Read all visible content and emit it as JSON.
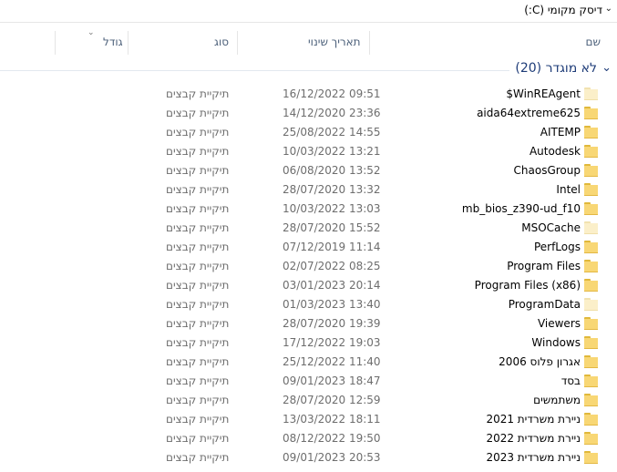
{
  "window": {
    "title": "דיסק מקומי (C:)"
  },
  "columns": {
    "name": "שם",
    "date_modified": "תאריך שינוי",
    "type": "סוג",
    "size": "גודל"
  },
  "group": {
    "label": "לא מוגדר (20)"
  },
  "files": [
    {
      "name": "$WinREAgent",
      "date": "16/12/2022 09:51",
      "type": "תיקיית קבצים",
      "icon": "folder-hidden-icon"
    },
    {
      "name": "aida64extreme625",
      "date": "14/12/2020 23:36",
      "type": "תיקיית קבצים",
      "icon": "folder-icon"
    },
    {
      "name": "AITEMP",
      "date": "25/08/2022 14:55",
      "type": "תיקיית קבצים",
      "icon": "folder-icon"
    },
    {
      "name": "Autodesk",
      "date": "10/03/2022 13:21",
      "type": "תיקיית קבצים",
      "icon": "folder-icon"
    },
    {
      "name": "ChaosGroup",
      "date": "06/08/2020 13:52",
      "type": "תיקיית קבצים",
      "icon": "folder-icon"
    },
    {
      "name": "Intel",
      "date": "28/07/2020 13:32",
      "type": "תיקיית קבצים",
      "icon": "folder-icon"
    },
    {
      "name": "mb_bios_z390-ud_f10",
      "date": "10/03/2022 13:03",
      "type": "תיקיית קבצים",
      "icon": "folder-icon"
    },
    {
      "name": "MSOCache",
      "date": "28/07/2020 15:52",
      "type": "תיקיית קבצים",
      "icon": "folder-hidden-icon"
    },
    {
      "name": "PerfLogs",
      "date": "07/12/2019 11:14",
      "type": "תיקיית קבצים",
      "icon": "folder-icon"
    },
    {
      "name": "Program Files",
      "date": "02/07/2022 08:25",
      "type": "תיקיית קבצים",
      "icon": "folder-icon"
    },
    {
      "name": "Program Files (x86)",
      "date": "03/01/2023 20:14",
      "type": "תיקיית קבצים",
      "icon": "folder-icon"
    },
    {
      "name": "ProgramData",
      "date": "01/03/2023 13:40",
      "type": "תיקיית קבצים",
      "icon": "folder-hidden-icon"
    },
    {
      "name": "Viewers",
      "date": "28/07/2020 19:39",
      "type": "תיקיית קבצים",
      "icon": "folder-icon"
    },
    {
      "name": "Windows",
      "date": "17/12/2022 19:03",
      "type": "תיקיית קבצים",
      "icon": "folder-icon"
    },
    {
      "name": "אגרון פלוס 2006",
      "date": "25/12/2022 11:40",
      "type": "תיקיית קבצים",
      "icon": "folder-icon"
    },
    {
      "name": "בסד",
      "date": "09/01/2023 18:47",
      "type": "תיקיית קבצים",
      "icon": "folder-icon"
    },
    {
      "name": "משתמשים",
      "date": "28/07/2020 12:59",
      "type": "תיקיית קבצים",
      "icon": "folder-icon"
    },
    {
      "name": "ניירת משרדית 2021",
      "date": "13/03/2022 18:11",
      "type": "תיקיית קבצים",
      "icon": "folder-icon"
    },
    {
      "name": "ניירת משרדית 2022",
      "date": "08/12/2022 19:50",
      "type": "תיקיית קבצים",
      "icon": "folder-icon"
    },
    {
      "name": "ניירת משרדית 2023",
      "date": "09/01/2023 20:53",
      "type": "תיקיית קבצים",
      "icon": "folder-icon"
    }
  ]
}
